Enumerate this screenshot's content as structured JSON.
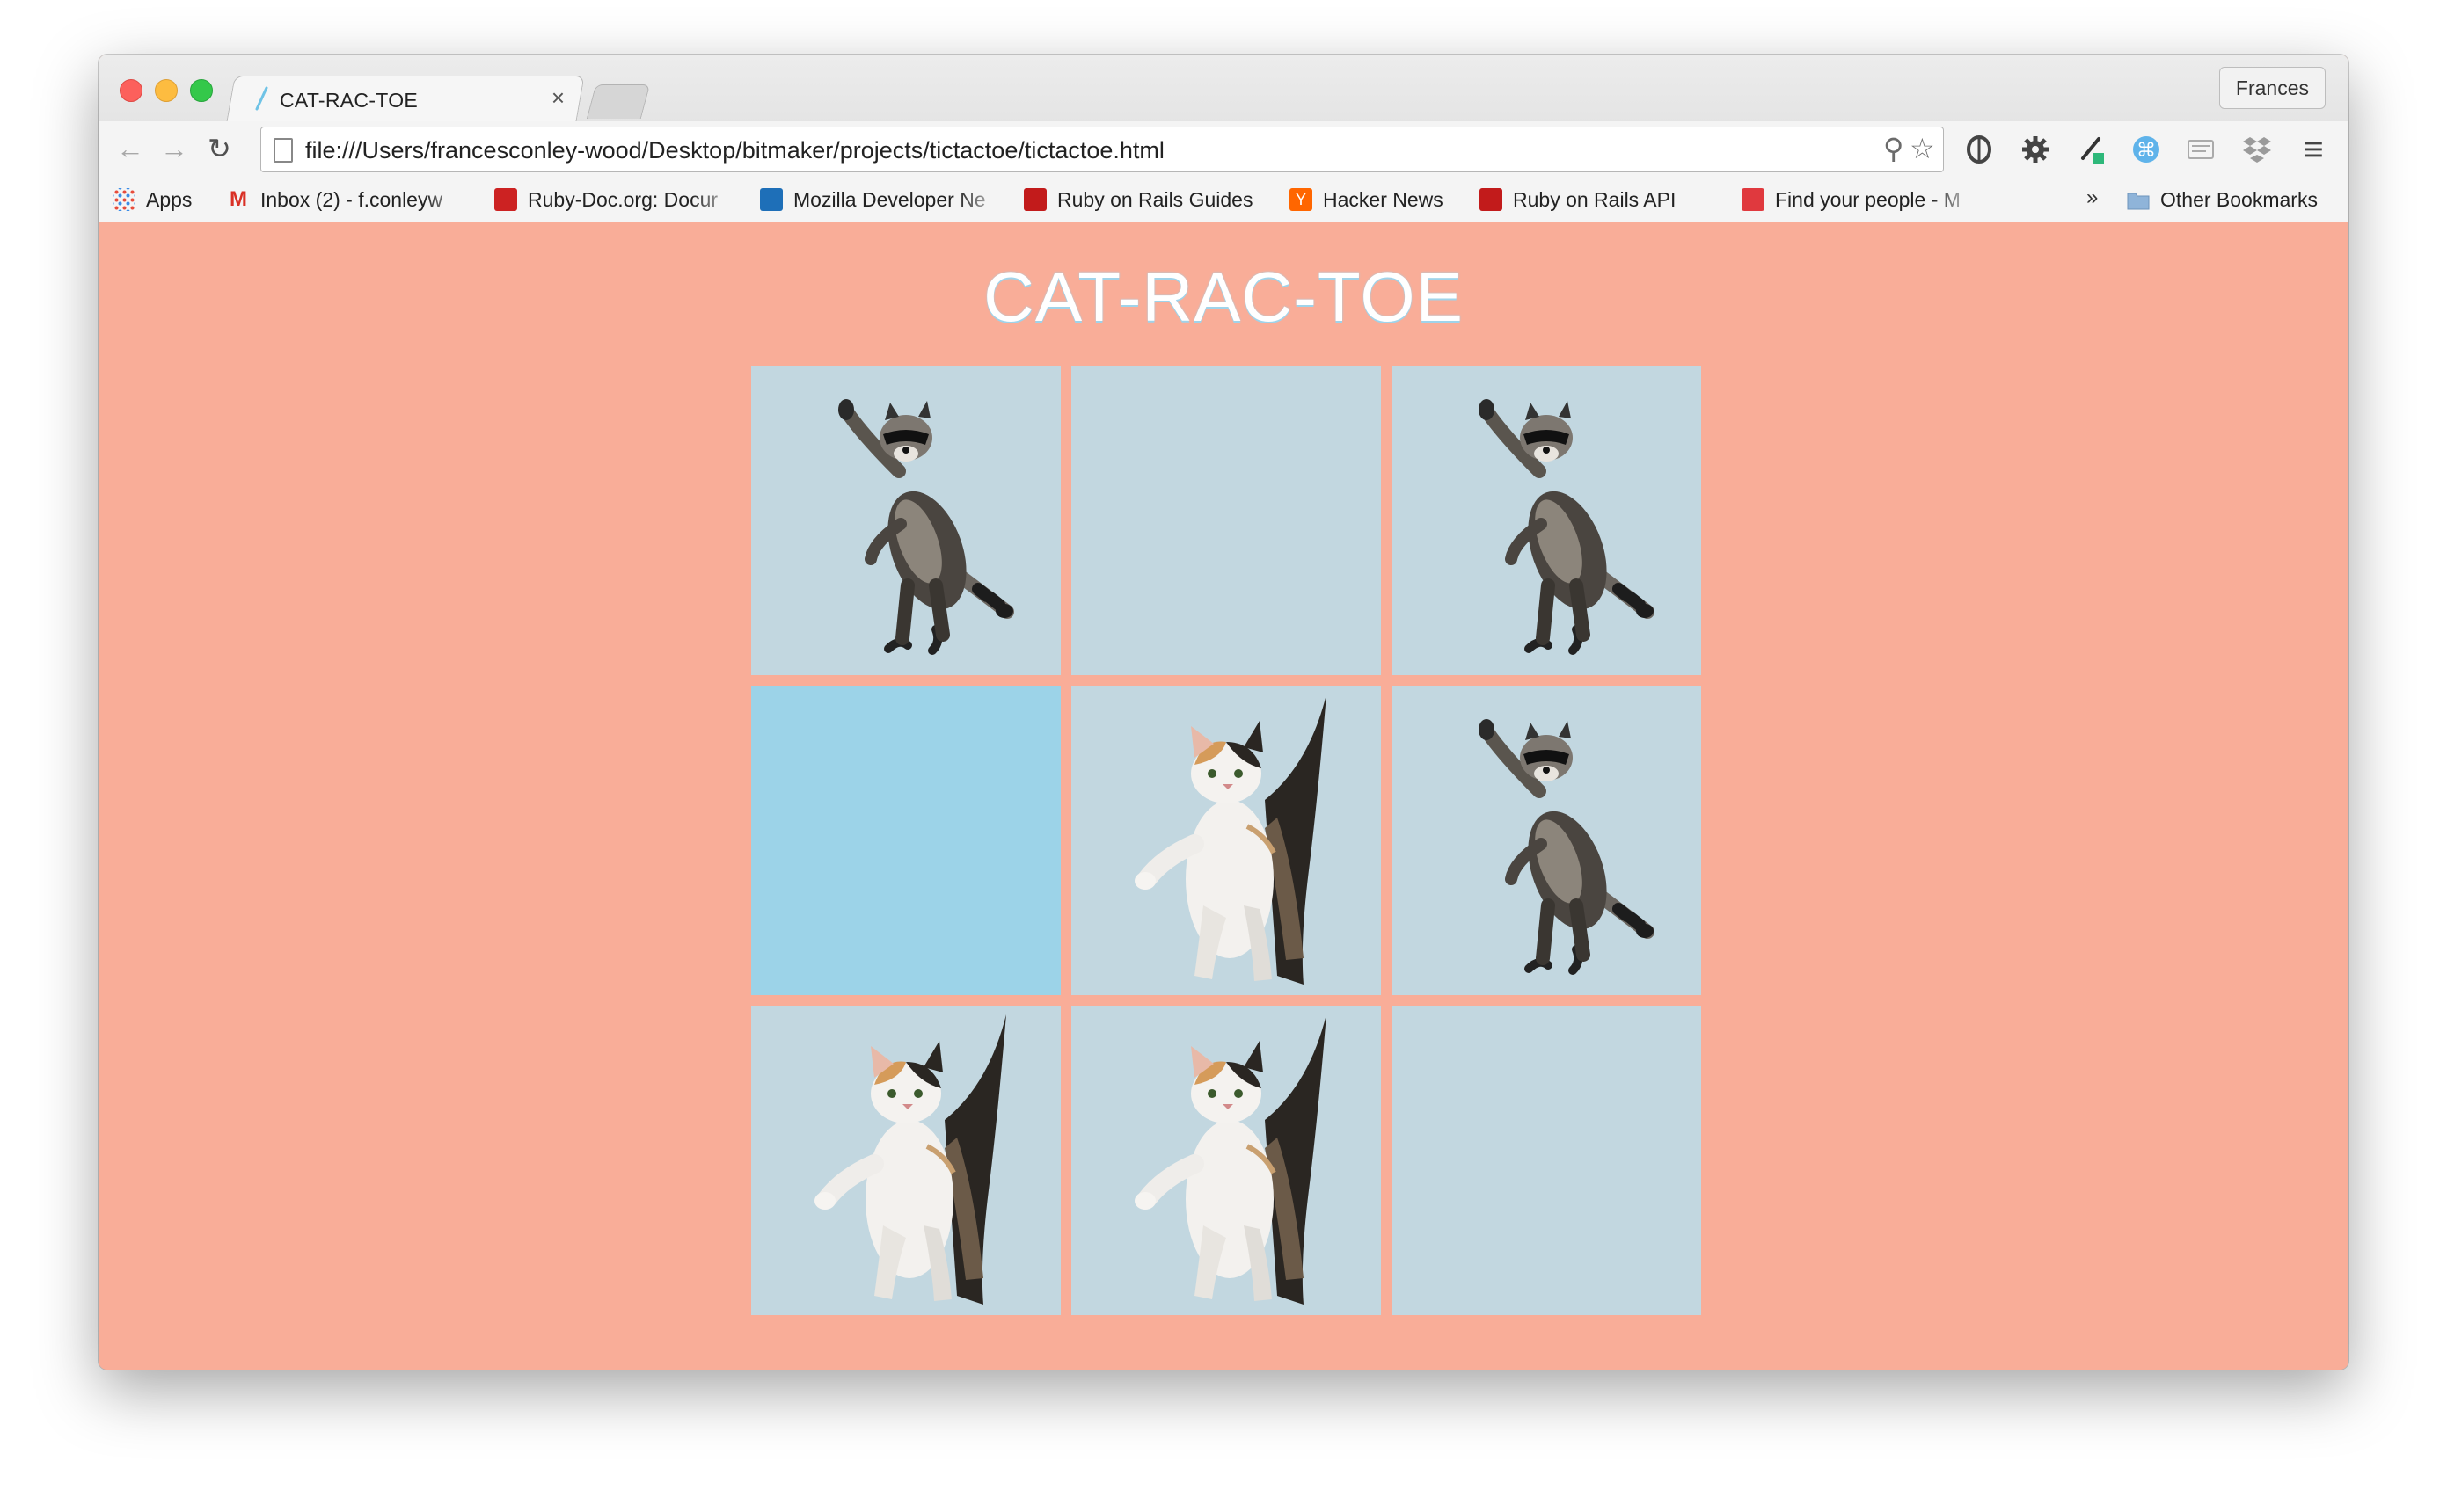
{
  "browser": {
    "tab_title": "CAT-RAC-TOE",
    "tab_close": "×",
    "profile_name": "Frances",
    "url": "file:///Users/francesconley-wood/Desktop/bitmaker/projects/tictactoe/tictactoe.html",
    "back_glyph": "←",
    "forward_glyph": "→",
    "reload_glyph": "↻",
    "zoom_glyph": "⚲",
    "star_glyph": "☆",
    "menu_glyph": "≡",
    "bookmarks": [
      {
        "label": "Apps",
        "icon": "apps-grid-icon",
        "color": "#e74c3c"
      },
      {
        "label": "Inbox (2) - f.conleyw",
        "icon": "gmail-icon",
        "color": "#d93025"
      },
      {
        "label": "Ruby-Doc.org: Docur",
        "icon": "ruby-icon",
        "color": "#cc2222"
      },
      {
        "label": "Mozilla Developer Ne",
        "icon": "mdn-icon",
        "color": "#1e6fb8"
      },
      {
        "label": "Ruby on Rails Guides",
        "icon": "rails-icon",
        "color": "#c21b1b"
      },
      {
        "label": "Hacker News",
        "icon": "hn-icon",
        "color": "#ff6600"
      },
      {
        "label": "Ruby on Rails API",
        "icon": "rails-icon",
        "color": "#c21b1b"
      },
      {
        "label": "Find your people - M",
        "icon": "meetup-icon",
        "color": "#e0393e"
      }
    ],
    "overflow_glyph": "»",
    "other_bookmarks": "Other Bookmarks"
  },
  "page": {
    "title": "CAT-RAC-TOE",
    "background": "#f9ad98",
    "cell_color": "#c2d7e0",
    "highlight_color": "#9cd3e8",
    "board": [
      [
        "raccoon",
        "",
        "raccoon"
      ],
      [
        "",
        "cat",
        "raccoon"
      ],
      [
        "cat",
        "cat",
        ""
      ]
    ],
    "hovered_cell": [
      1,
      0
    ]
  }
}
